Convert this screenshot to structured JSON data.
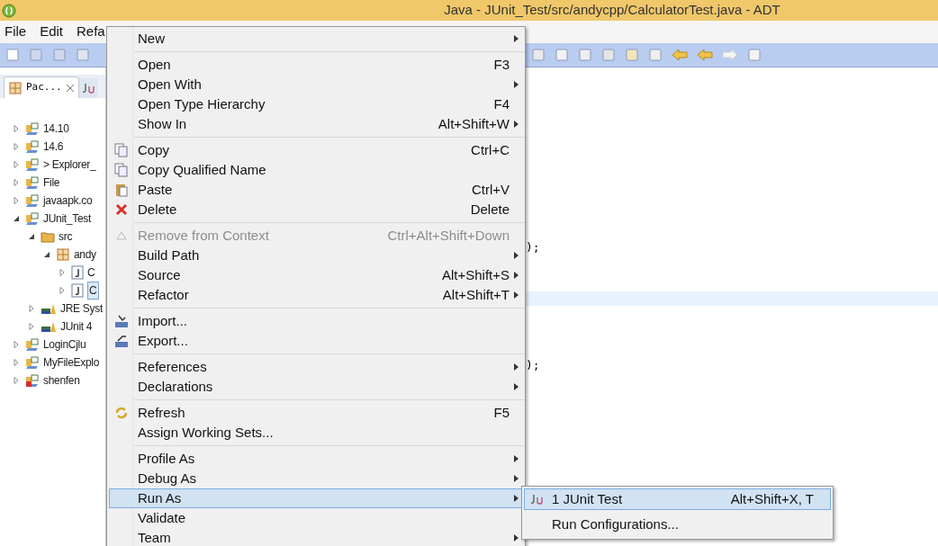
{
  "window": {
    "title": "Java - JUnit_Test/src/andycpp/CalculatorTest.java - ADT"
  },
  "menubar": [
    "File",
    "Edit",
    "Refa"
  ],
  "tabs": [
    {
      "label": "Pac...",
      "selected": true,
      "kind": "package"
    },
    {
      "selected": false,
      "kind": "junit"
    }
  ],
  "tree": [
    {
      "label": "14.10",
      "expanded": false,
      "kind": "project"
    },
    {
      "label": "14.6",
      "expanded": false,
      "kind": "project"
    },
    {
      "label": "> Explorer_",
      "expanded": false,
      "kind": "project"
    },
    {
      "label": "File",
      "expanded": false,
      "kind": "project"
    },
    {
      "label": "javaapk.co",
      "expanded": false,
      "kind": "project"
    },
    {
      "label": "JUnit_Test",
      "expanded": true,
      "kind": "project",
      "children": [
        {
          "label": "src",
          "expanded": true,
          "kind": "folder",
          "children": [
            {
              "label": "andy",
              "expanded": true,
              "kind": "package",
              "children": [
                {
                  "label": "C",
                  "expanded": false,
                  "kind": "java",
                  "selected": false
                },
                {
                  "label": "C",
                  "expanded": false,
                  "kind": "java",
                  "selected": true
                }
              ]
            }
          ]
        },
        {
          "label": "JRE Syst",
          "expanded": false,
          "kind": "library"
        },
        {
          "label": "JUnit 4",
          "expanded": false,
          "kind": "library"
        }
      ]
    },
    {
      "label": "LoginCjlu",
      "expanded": false,
      "kind": "project"
    },
    {
      "label": "MyFileExplo",
      "expanded": false,
      "kind": "project"
    },
    {
      "label": "shenfen",
      "expanded": false,
      "kind": "error"
    }
  ],
  "editor": {
    "lines": [
      {
        "text": ");",
        "highlighted": false
      },
      {
        "highlighted": true
      },
      {
        "text": ");",
        "highlighted": false
      }
    ]
  },
  "context_menu": [
    {
      "kind": "plain",
      "label": "New",
      "submenu": true
    },
    {
      "kind": "separator"
    },
    {
      "kind": "plain",
      "label": "Open",
      "shortcut": "F3"
    },
    {
      "kind": "plain",
      "label": "Open With",
      "submenu": true
    },
    {
      "kind": "plain",
      "label": "Open Type Hierarchy",
      "shortcut": "F4"
    },
    {
      "kind": "plain",
      "label": "Show In",
      "shortcut": "Alt+Shift+W",
      "submenu": true
    },
    {
      "kind": "separator"
    },
    {
      "kind": "copy",
      "label": "Copy",
      "shortcut": "Ctrl+C"
    },
    {
      "kind": "copy",
      "label": "Copy Qualified Name"
    },
    {
      "kind": "paste",
      "label": "Paste",
      "shortcut": "Ctrl+V"
    },
    {
      "kind": "delete",
      "label": "Delete",
      "shortcut": "Delete"
    },
    {
      "kind": "separator"
    },
    {
      "kind": "remove",
      "label": "Remove from Context",
      "shortcut": "Ctrl+Alt+Shift+Down",
      "disabled": true
    },
    {
      "kind": "plain",
      "label": "Build Path",
      "submenu": true
    },
    {
      "kind": "plain",
      "label": "Source",
      "shortcut": "Alt+Shift+S",
      "submenu": true
    },
    {
      "kind": "plain",
      "label": "Refactor",
      "shortcut": "Alt+Shift+T",
      "submenu": true
    },
    {
      "kind": "separator"
    },
    {
      "kind": "import",
      "label": "Import..."
    },
    {
      "kind": "export",
      "label": "Export..."
    },
    {
      "kind": "separator"
    },
    {
      "kind": "plain",
      "label": "References",
      "submenu": true
    },
    {
      "kind": "plain",
      "label": "Declarations",
      "submenu": true
    },
    {
      "kind": "separator"
    },
    {
      "kind": "refresh",
      "label": "Refresh",
      "shortcut": "F5"
    },
    {
      "kind": "plain",
      "label": "Assign Working Sets..."
    },
    {
      "kind": "separator"
    },
    {
      "kind": "plain",
      "label": "Profile As",
      "submenu": true
    },
    {
      "kind": "plain",
      "label": "Debug As",
      "submenu": true
    },
    {
      "kind": "plain",
      "label": "Run As",
      "submenu": true,
      "selected": true
    },
    {
      "kind": "plain",
      "label": "Validate"
    },
    {
      "kind": "plain",
      "label": "Team",
      "submenu": true
    }
  ],
  "submenu": [
    {
      "label": "1 JUnit Test",
      "shortcut": "Alt+Shift+X, T",
      "kind": "junit",
      "selected": true
    },
    {
      "label": "Run Configurations...",
      "kind": "plain",
      "selected": false
    }
  ]
}
